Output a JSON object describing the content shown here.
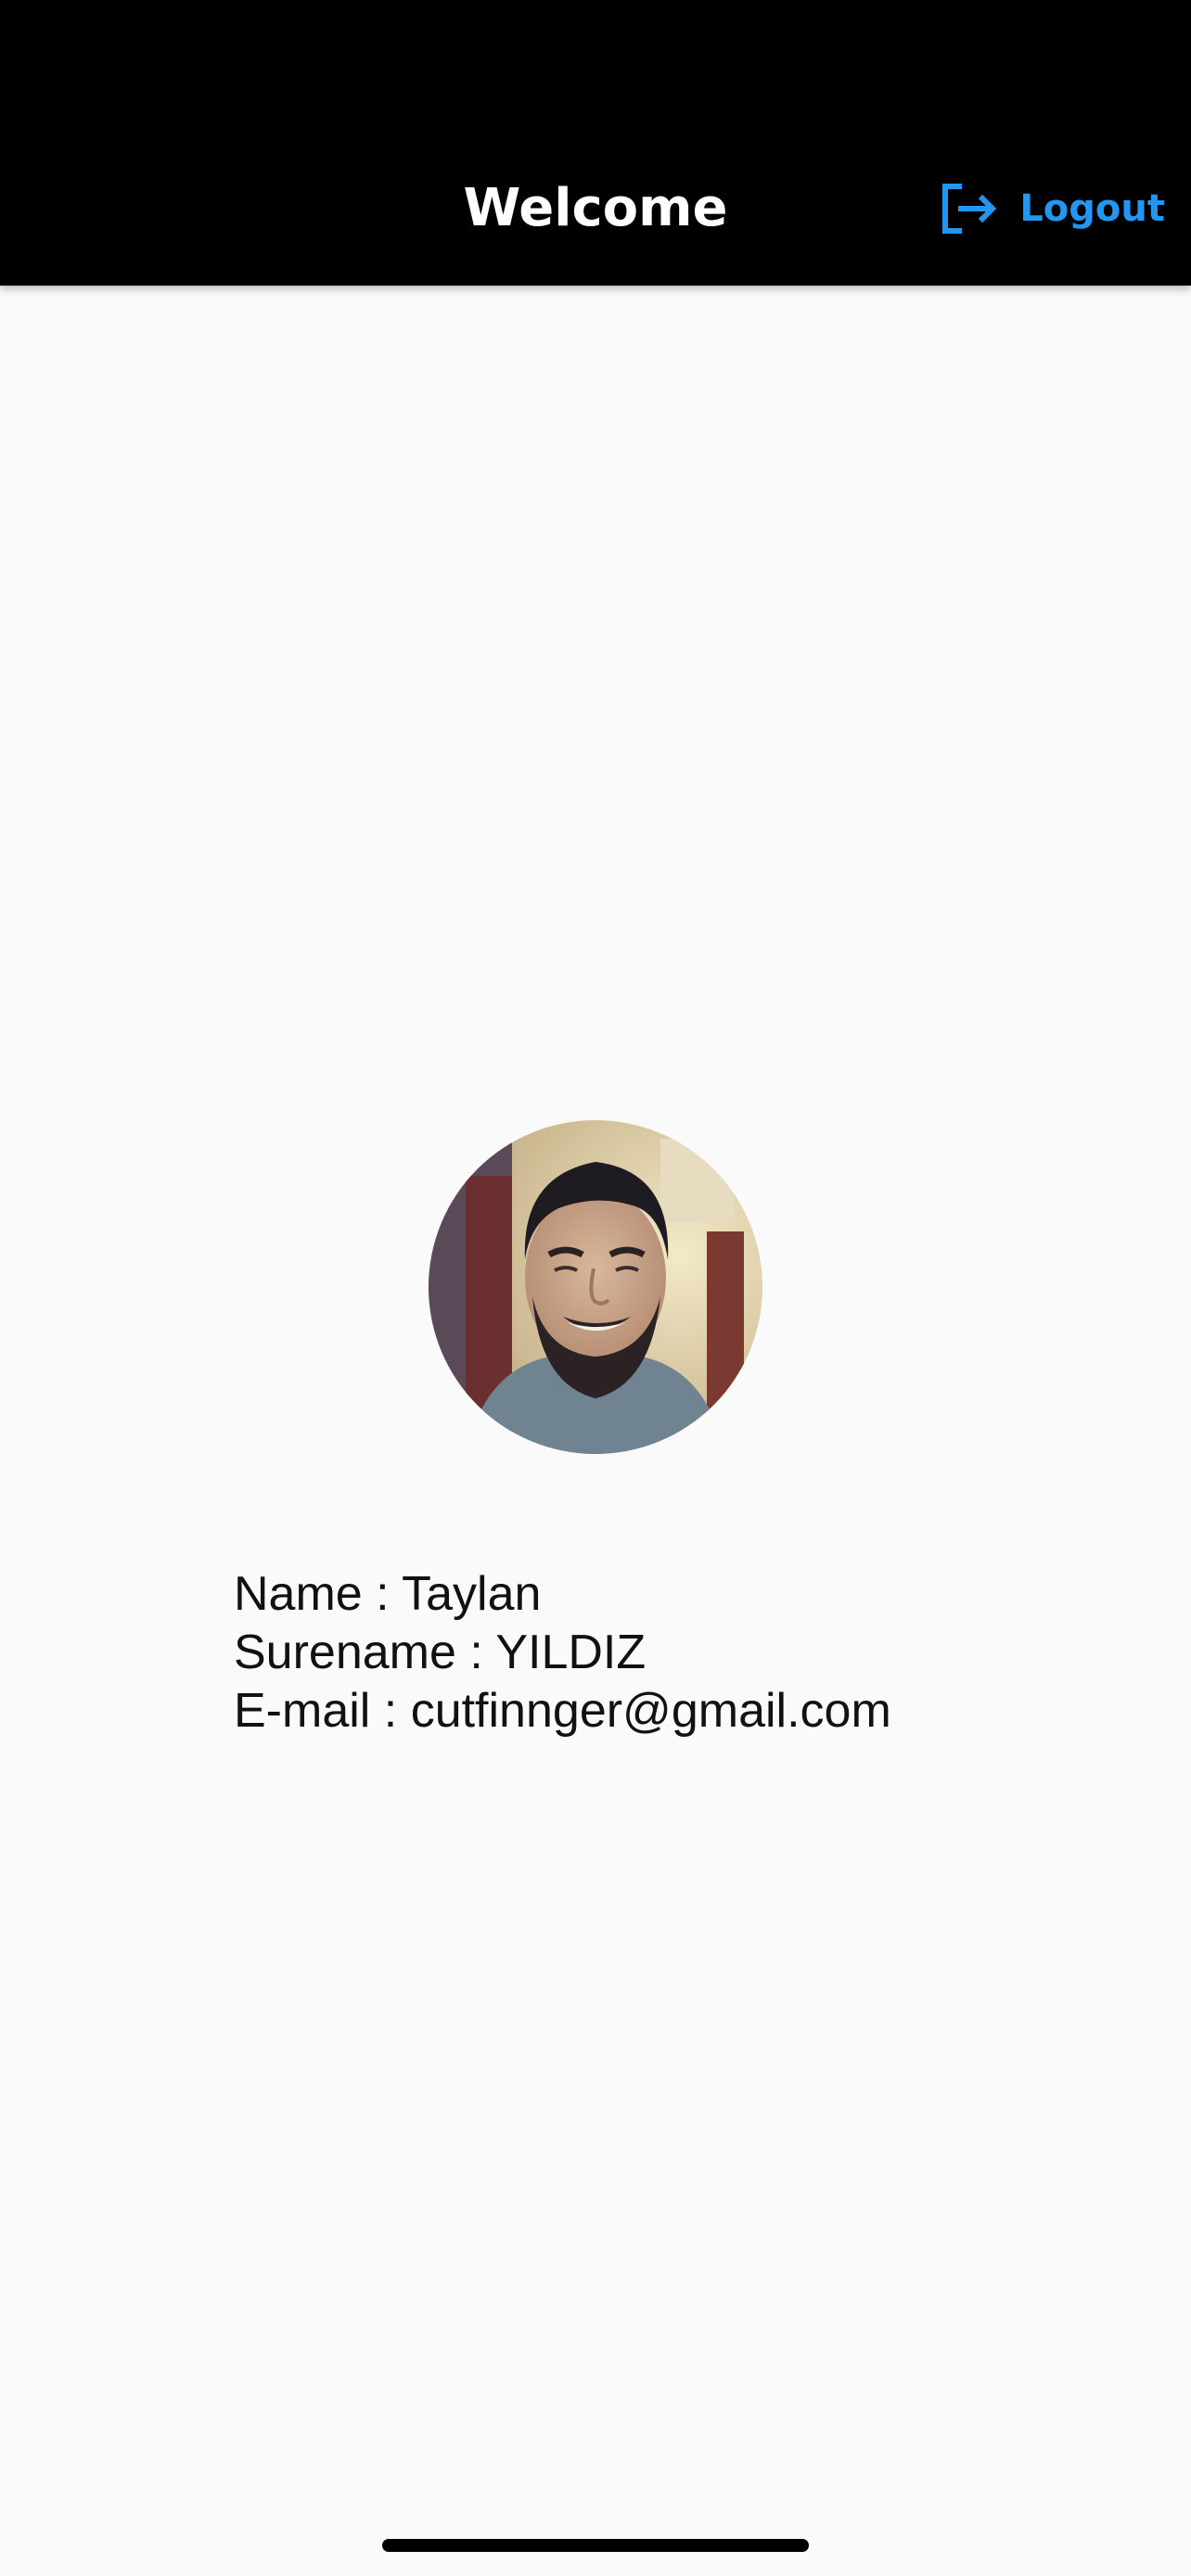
{
  "app_bar": {
    "title": "Welcome",
    "logout_label": "Logout",
    "logout_icon": "logout-icon",
    "background": "#000000",
    "accent": "#2196f3"
  },
  "profile": {
    "avatar_icon": "profile-photo",
    "name_label": "Name : ",
    "name_value": "Taylan",
    "surname_label": "Surename : ",
    "surname_value": "YILDIZ",
    "email_label": "E-mail : ",
    "email_value": "cutfinnger@gmail.com"
  }
}
